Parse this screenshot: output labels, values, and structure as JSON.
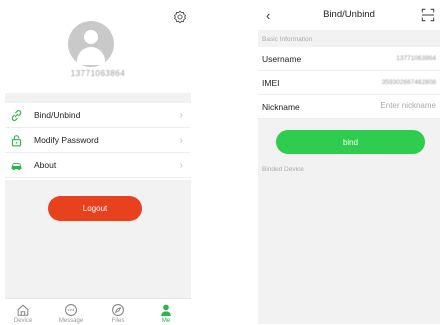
{
  "me_page": {
    "profile": {
      "user_id": "13771063864"
    },
    "menu": [
      {
        "label": "Bind/Unbind",
        "icon": "link-icon"
      },
      {
        "label": "Modify Password",
        "icon": "lock-icon"
      },
      {
        "label": "About",
        "icon": "car-icon"
      }
    ],
    "chevron": "›",
    "logout_label": "Logout",
    "tabs": [
      {
        "label": "Device",
        "icon": "home-icon",
        "active": false
      },
      {
        "label": "Message",
        "icon": "message-icon",
        "active": false
      },
      {
        "label": "Files",
        "icon": "compass-icon",
        "active": false
      },
      {
        "label": "Me",
        "icon": "person-icon",
        "active": true
      }
    ]
  },
  "bind_page": {
    "title": "Bind/Unbind",
    "back_glyph": "‹",
    "section_basic": "Basic Information",
    "rows": {
      "username": {
        "label": "Username",
        "value": "13771063864"
      },
      "imei": {
        "label": "IMEI",
        "value": "359302667462808"
      },
      "nickname": {
        "label": "Nickname",
        "placeholder": "Enter nickname"
      }
    },
    "bind_label": "bind",
    "section_binded": "Binded Device"
  },
  "colors": {
    "accent_green": "#2ecc4f",
    "logout_red": "#e8411d",
    "background_gray": "#f2f2f2"
  }
}
